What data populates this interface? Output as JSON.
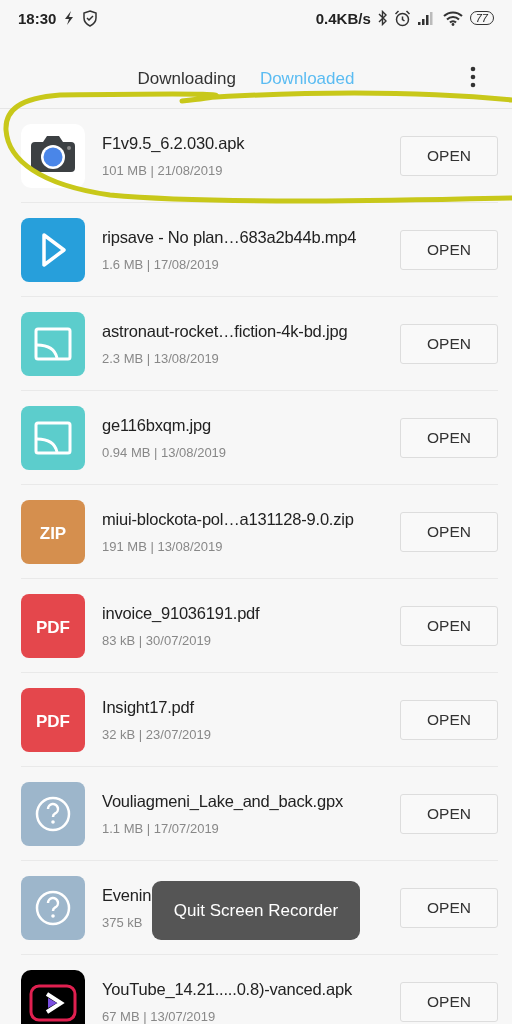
{
  "status_bar": {
    "time": "18:30",
    "speed": "0.4KB/s",
    "battery": "77"
  },
  "tabs": [
    {
      "label": "Downloading",
      "selected": false
    },
    {
      "label": "Downloaded",
      "selected": true
    }
  ],
  "files": [
    {
      "kind": "camera",
      "name": "F1v9.5_6.2.030.apk",
      "meta": "101 MB | 21/08/2019",
      "action": "OPEN"
    },
    {
      "kind": "video",
      "name": "ripsave - No plan…683a2b44b.mp4",
      "meta": "1.6 MB | 17/08/2019",
      "action": "OPEN"
    },
    {
      "kind": "image",
      "name": "astronaut-rocket…fiction-4k-bd.jpg",
      "meta": "2.3 MB | 13/08/2019",
      "action": "OPEN"
    },
    {
      "kind": "image",
      "name": "ge116bxqm.jpg",
      "meta": "0.94 MB | 13/08/2019",
      "action": "OPEN"
    },
    {
      "kind": "zip",
      "name": "miui-blockota-pol…a131128-9.0.zip",
      "meta": "191 MB | 13/08/2019",
      "action": "OPEN",
      "badge": "ZIP"
    },
    {
      "kind": "pdf",
      "name": "invoice_91036191.pdf",
      "meta": "83 kB | 30/07/2019",
      "action": "OPEN",
      "badge": "PDF"
    },
    {
      "kind": "pdf",
      "name": "Insight17.pdf",
      "meta": "32 kB | 23/07/2019",
      "action": "OPEN",
      "badge": "PDF"
    },
    {
      "kind": "unknown",
      "name": "Vouliagmeni_Lake_and_back.gpx",
      "meta": "1.1 MB | 17/07/2019",
      "action": "OPEN"
    },
    {
      "kind": "unknown",
      "name": "Evenin",
      "meta": "375 kB",
      "action": "OPEN"
    },
    {
      "kind": "vanced",
      "name": "YouTube_14.21.....0.8)-vanced.apk",
      "meta": "67 MB | 13/07/2019",
      "action": "OPEN"
    }
  ],
  "toast": "Quit Screen Recorder"
}
